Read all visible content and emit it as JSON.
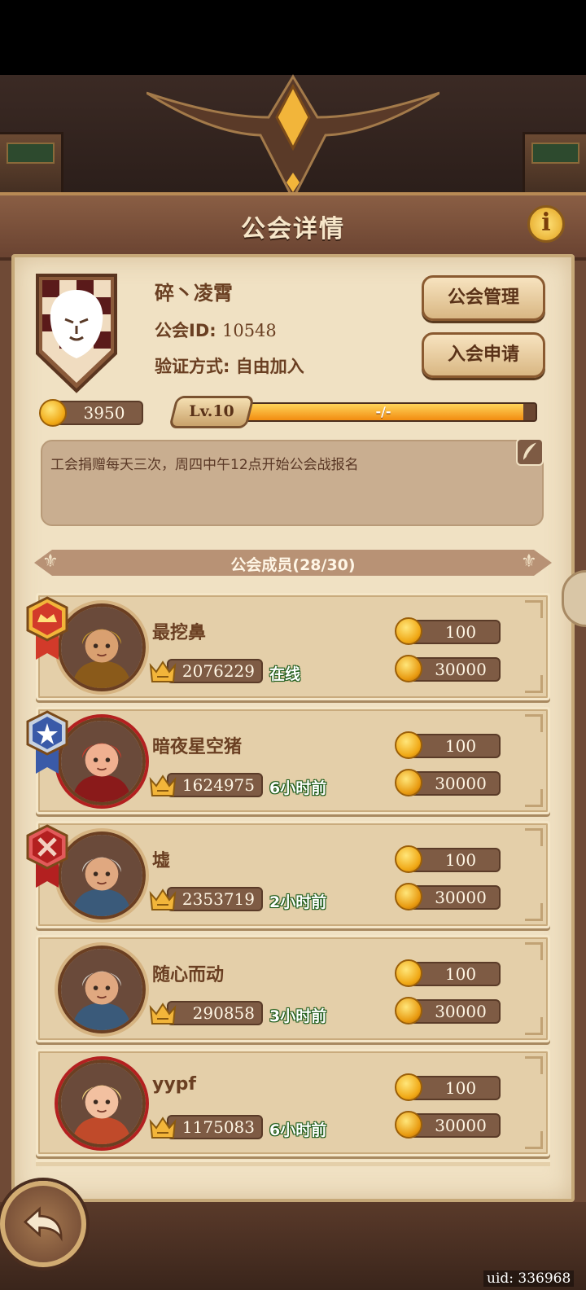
{
  "header": {
    "title": "公会详情",
    "info_label": "i"
  },
  "guild": {
    "name": "碎丶凌霄",
    "id_label": "公会ID: ",
    "id_value": "10548",
    "verify_label": "验证方式: 自由加入",
    "coins": "3950",
    "level": "Lv.10",
    "progress_text": "-/-",
    "notice": "工会捐赠每天三次，周四中午12点开始公会战报名"
  },
  "buttons": {
    "manage": "公会管理",
    "apply": "入会申请"
  },
  "members_section": {
    "title": "公会成员(28/30)"
  },
  "members": [
    {
      "name": "最挖鼻",
      "power": "2076229",
      "status": "在线",
      "coin_value": "100",
      "contrib_value": "30000",
      "medal": "leader-crown-medal",
      "portrait": "hooded-rogue"
    },
    {
      "name": "暗夜星空猪",
      "power": "1624975",
      "status": "6小时前",
      "coin_value": "100",
      "contrib_value": "30000",
      "medal": "vice-star-medal",
      "portrait": "red-hair-warrior"
    },
    {
      "name": "墟",
      "power": "2353719",
      "status": "2小时前",
      "coin_value": "100",
      "contrib_value": "30000",
      "medal": "elder-swords-medal",
      "portrait": "goggles-engineer"
    },
    {
      "name": "随心而动",
      "power": "290858",
      "status": "3小时前",
      "coin_value": "100",
      "contrib_value": "30000",
      "medal": "",
      "portrait": "goggles-engineer"
    },
    {
      "name": "yypf",
      "power": "1175083",
      "status": "6小时前",
      "coin_value": "100",
      "contrib_value": "30000",
      "medal": "",
      "portrait": "blonde-elf"
    }
  ],
  "footer": {
    "uid": "uid: 336968"
  },
  "colors": {
    "parchment": "#f0e1c3",
    "wood": "#6f4a36",
    "gold": "#f0a815",
    "online_green": "#1b5a18"
  }
}
